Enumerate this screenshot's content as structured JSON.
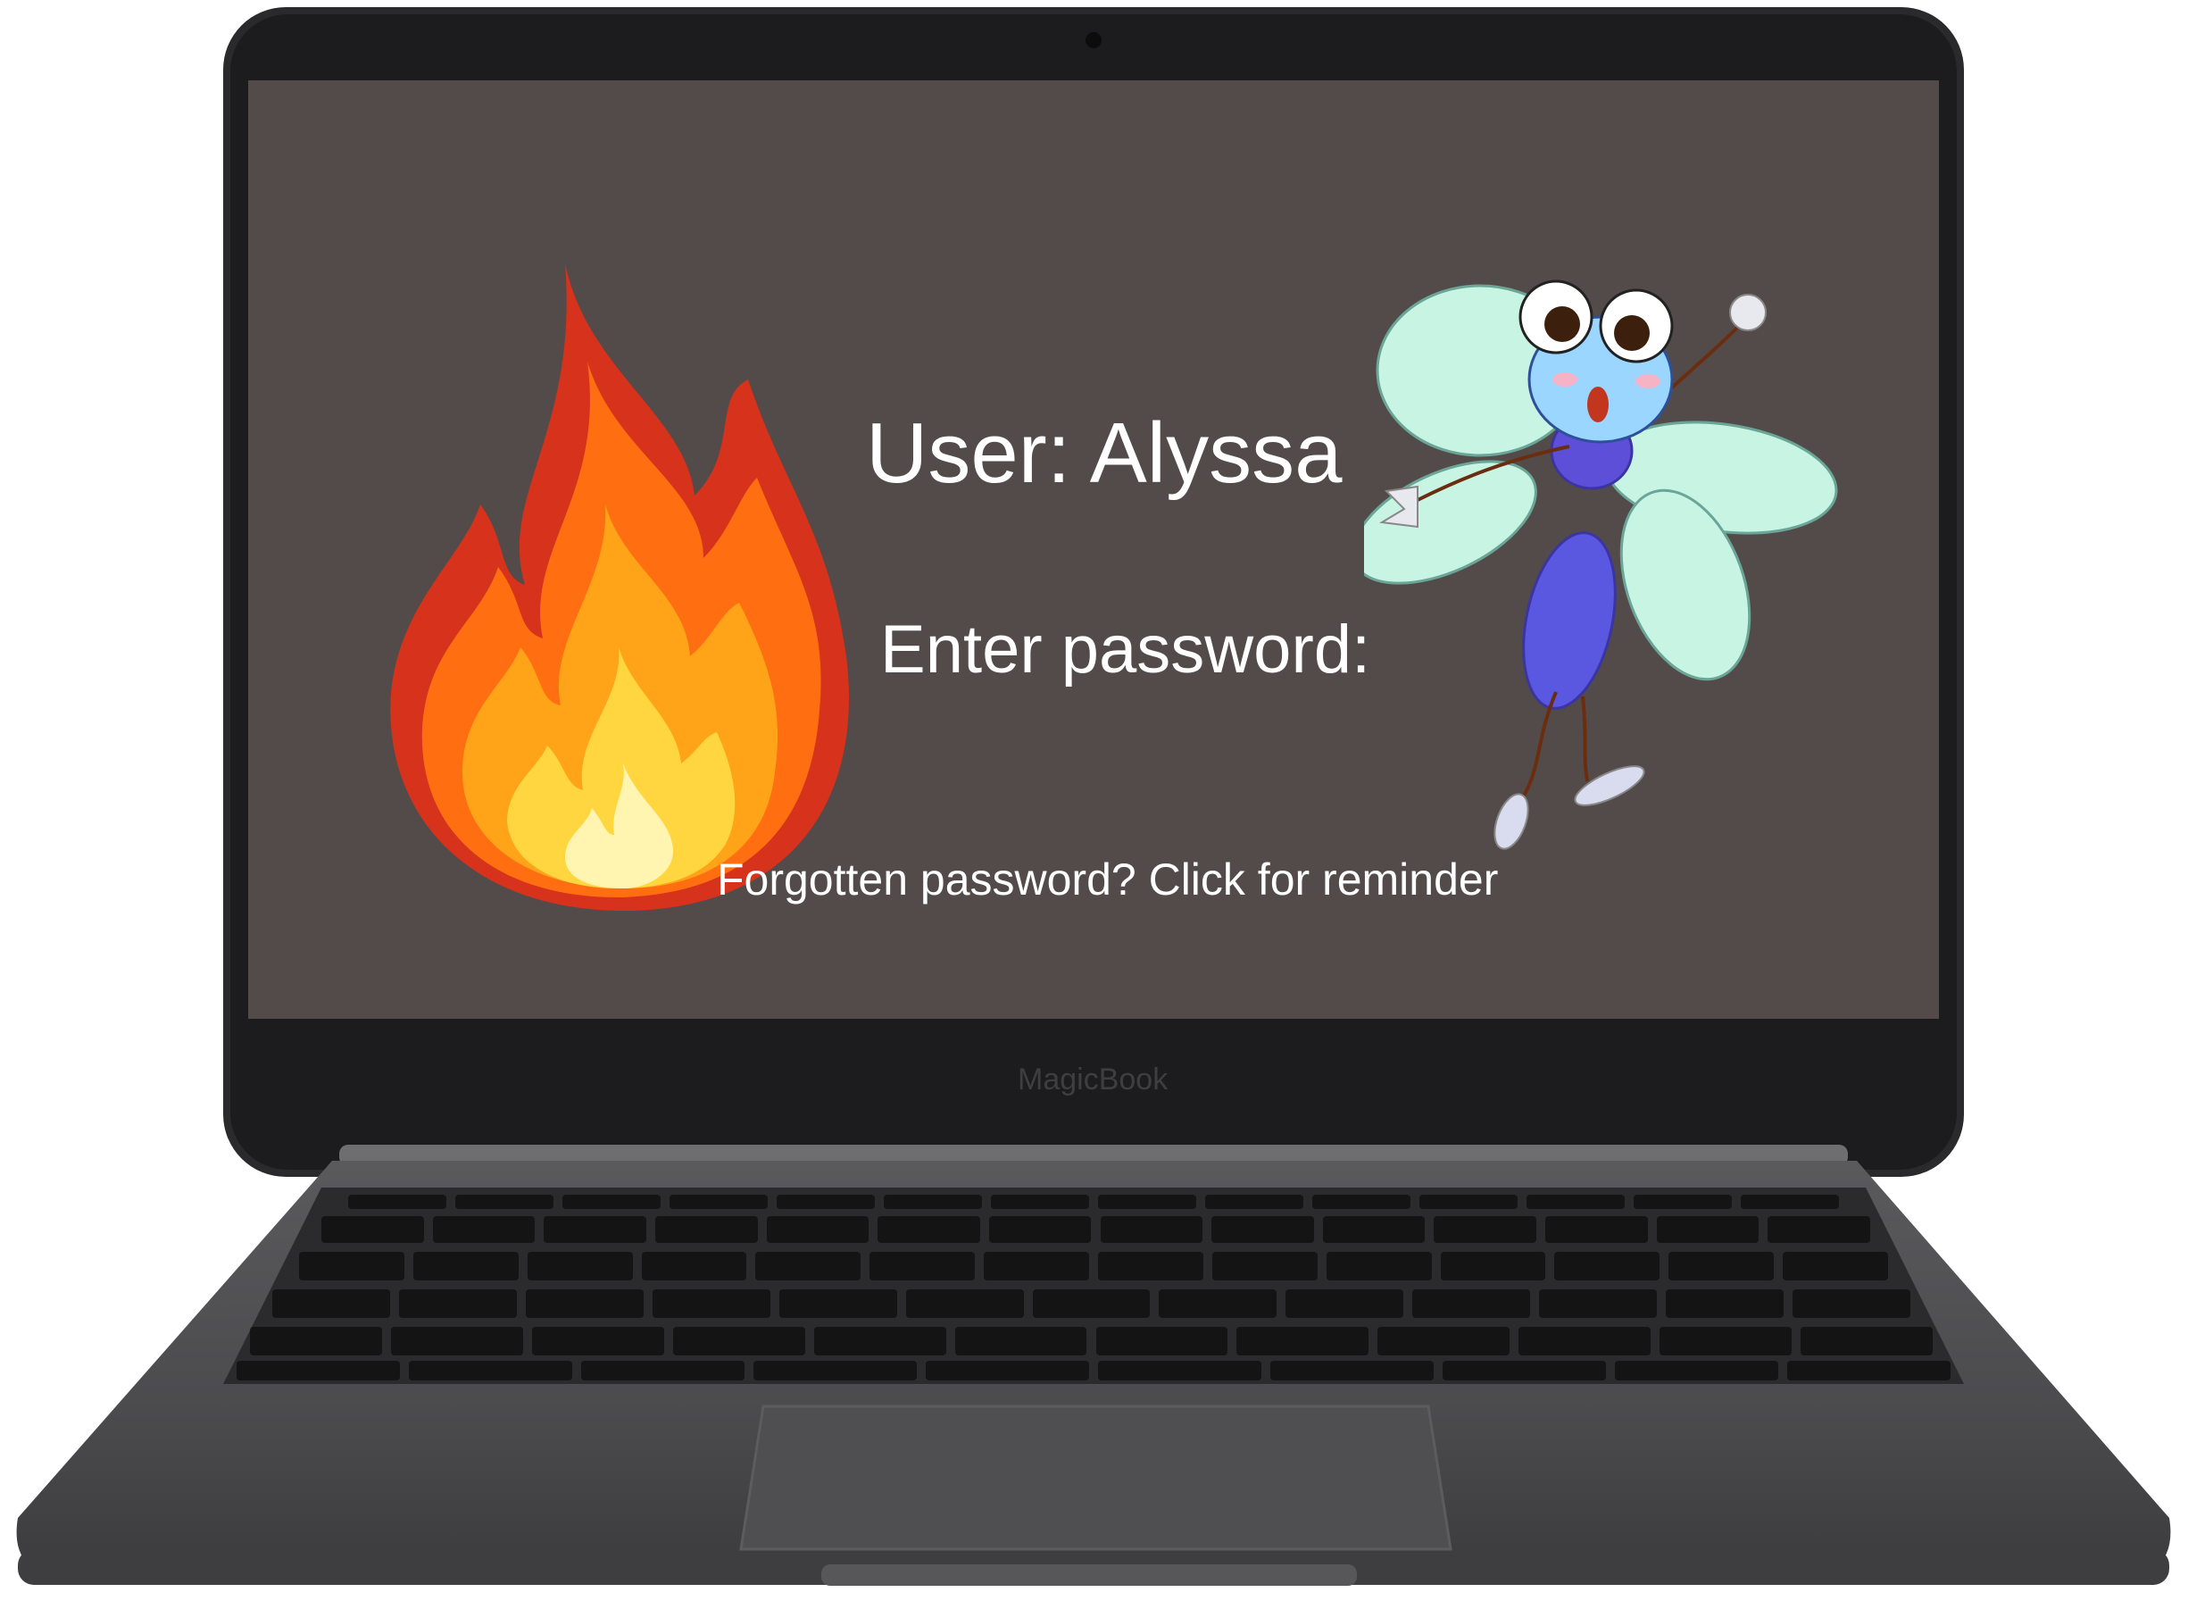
{
  "login": {
    "user_label": "User: Alyssa",
    "password_label": "Enter password:",
    "password_value": "",
    "reminder_link": "Forgotten password? Click for reminder"
  },
  "laptop": {
    "brand": "MagicBook"
  },
  "illustrations": {
    "left": "fire-icon",
    "right": "dragonfly-icon"
  },
  "colors": {
    "screen_bg": "#534b49",
    "text": "#ffffff",
    "bezel": "#1c1c1e",
    "chassis": "#4a4a4c"
  }
}
